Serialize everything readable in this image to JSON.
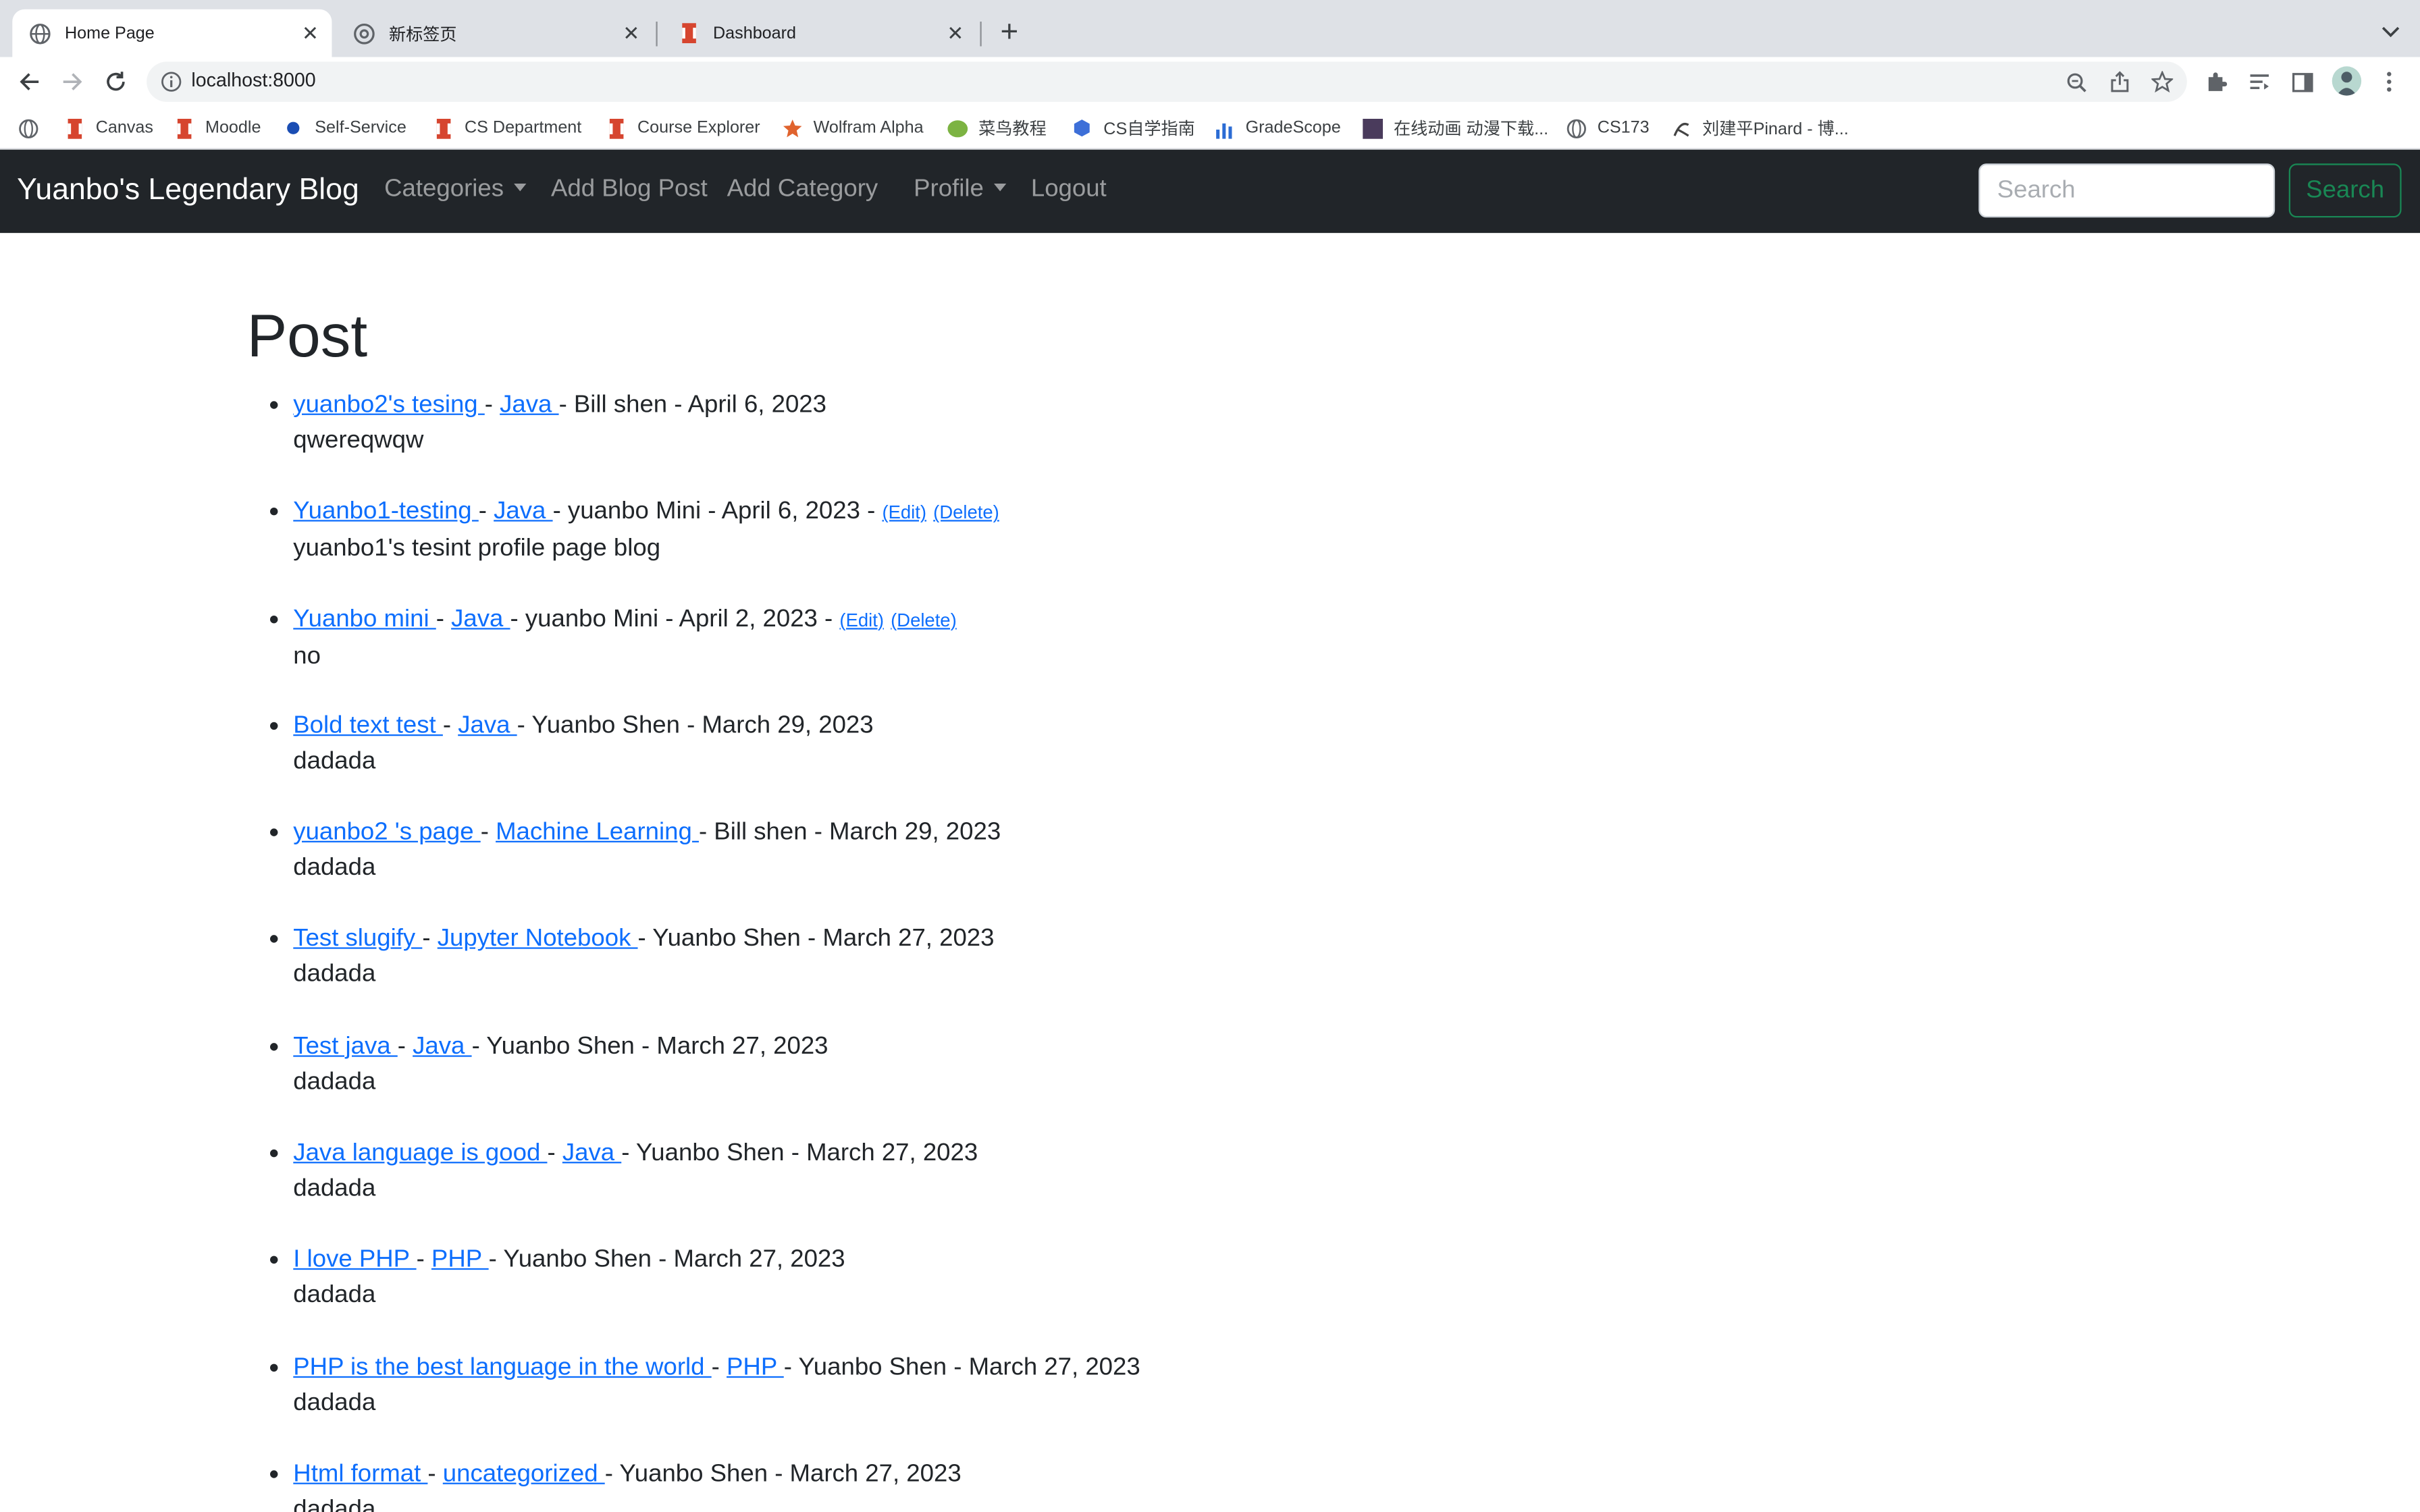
{
  "browser": {
    "tabs": [
      {
        "title": "Home Page",
        "active": true
      },
      {
        "title": "新标签页",
        "active": false
      },
      {
        "title": "Dashboard",
        "active": false
      }
    ],
    "url": "localhost:8000",
    "bookmarks": [
      "Canvas",
      "Moodle",
      "Self-Service",
      "CS Department",
      "Course Explorer",
      "Wolfram Alpha",
      "菜鸟教程",
      "CS自学指南",
      "GradeScope",
      "在线动画 动漫下载...",
      "CS173",
      "刘建平Pinard - 博..."
    ]
  },
  "site": {
    "brand": "Yuanbo's Legendary Blog",
    "nav": {
      "categories": "Categories",
      "add_blog_post": "Add Blog Post",
      "add_category": "Add Category",
      "profile": "Profile",
      "logout": "Logout"
    },
    "search_placeholder": "Search",
    "search_button": "Search",
    "colors": {
      "navbar": "#212529",
      "link": "#0d6efd",
      "search_button": "#198754"
    }
  },
  "page": {
    "heading": "Post",
    "edit_label": "(Edit)",
    "delete_label": "(Delete)",
    "posts": [
      {
        "title": "yuanbo2's tesing ",
        "category": "Java ",
        "meta": "- Bill shen - April 6, 2023",
        "body": "qwereqwqw",
        "editable": false
      },
      {
        "title": "Yuanbo1-testing ",
        "category": "Java ",
        "meta": "- yuanbo Mini - April 6, 2023 -",
        "body": "yuanbo1's tesint profile page blog",
        "editable": true
      },
      {
        "title": "Yuanbo mini ",
        "category": "Java ",
        "meta": "- yuanbo Mini - April 2, 2023 -",
        "body": "no",
        "editable": true
      },
      {
        "title": "Bold text test ",
        "category": "Java ",
        "meta": "- Yuanbo Shen - March 29, 2023",
        "body": "dadada",
        "editable": false
      },
      {
        "title": "yuanbo2 's page ",
        "category": "Machine Learning ",
        "meta": "- Bill shen - March 29, 2023",
        "body": "dadada",
        "editable": false
      },
      {
        "title": "Test slugify ",
        "category": "Jupyter Notebook ",
        "meta": "- Yuanbo Shen - March 27, 2023",
        "body": "dadada",
        "editable": false
      },
      {
        "title": "Test java ",
        "category": "Java ",
        "meta": "- Yuanbo Shen - March 27, 2023",
        "body": "dadada",
        "editable": false
      },
      {
        "title": "Java language is good ",
        "category": "Java ",
        "meta": "- Yuanbo Shen - March 27, 2023",
        "body": "dadada",
        "editable": false
      },
      {
        "title": "I love PHP ",
        "category": "PHP ",
        "meta": "- Yuanbo Shen - March 27, 2023",
        "body": "dadada",
        "editable": false
      },
      {
        "title": "PHP is the best language in the world ",
        "category": "PHP ",
        "meta": "- Yuanbo Shen - March 27, 2023",
        "body": "dadada",
        "editable": false
      },
      {
        "title": "Html format ",
        "category": "uncategorized ",
        "meta": "- Yuanbo Shen - March 27, 2023",
        "body": "dadada",
        "editable": false
      }
    ]
  }
}
